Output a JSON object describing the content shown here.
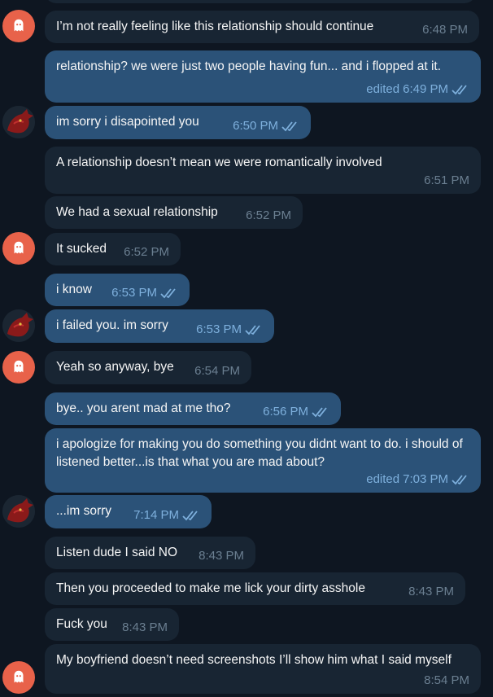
{
  "messages": [
    {
      "dir": "in",
      "text": "I’m not really feeling like this relationship should continue",
      "time": "6:48 PM",
      "edited": "",
      "read": false
    },
    {
      "dir": "out",
      "text": "relationship? we were just two people having fun... and i flopped at it.",
      "time": "6:49 PM",
      "edited": "edited",
      "read": true
    },
    {
      "dir": "out",
      "text": "im sorry i disapointed you",
      "time": "6:50 PM",
      "edited": "",
      "read": true
    },
    {
      "dir": "in",
      "text": "A relationship doesn’t mean we were romantically involved",
      "time": "6:51 PM",
      "edited": "",
      "read": false
    },
    {
      "dir": "in",
      "text": "We had a sexual relationship",
      "time": "6:52 PM",
      "edited": "",
      "read": false
    },
    {
      "dir": "in",
      "text": "It sucked",
      "time": "6:52 PM",
      "edited": "",
      "read": false
    },
    {
      "dir": "out",
      "text": "i know",
      "time": "6:53 PM",
      "edited": "",
      "read": true
    },
    {
      "dir": "out",
      "text": "i failed you. im sorry",
      "time": "6:53 PM",
      "edited": "",
      "read": true
    },
    {
      "dir": "in",
      "text": "Yeah so anyway, bye",
      "time": "6:54 PM",
      "edited": "",
      "read": false
    },
    {
      "dir": "out",
      "text": "bye.. you arent mad at me tho?",
      "time": "6:56 PM",
      "edited": "",
      "read": true
    },
    {
      "dir": "out",
      "text": "i apologize for making you do something you didnt want to do. i should of listened better...is that what you are mad about?",
      "time": "7:03 PM",
      "edited": "edited",
      "read": true
    },
    {
      "dir": "out",
      "text": "...im sorry",
      "time": "7:14 PM",
      "edited": "",
      "read": true
    },
    {
      "dir": "in",
      "text": "Listen dude I said NO",
      "time": "8:43 PM",
      "edited": "",
      "read": false
    },
    {
      "dir": "in",
      "text": "Then you proceeded to make me lick your dirty asshole",
      "time": "8:43 PM",
      "edited": "",
      "read": false
    },
    {
      "dir": "in",
      "text": "Fuck you",
      "time": "8:43 PM",
      "edited": "",
      "read": false
    },
    {
      "dir": "in",
      "text": "My boyfriend doesn’t need screenshots I’ll show him what I said myself",
      "time": "8:54 PM",
      "edited": "",
      "read": false
    }
  ],
  "avatars": {
    "contact_icon": "ghost-icon",
    "contact_color": "#e8624a",
    "user_icon": "dragon-avatar-image"
  },
  "colors": {
    "background": "#0e1621",
    "incoming_bubble": "#182533",
    "outgoing_bubble": "#2b5278",
    "outgoing_meta": "#7eb0dd",
    "incoming_meta": "#6b7f91"
  }
}
